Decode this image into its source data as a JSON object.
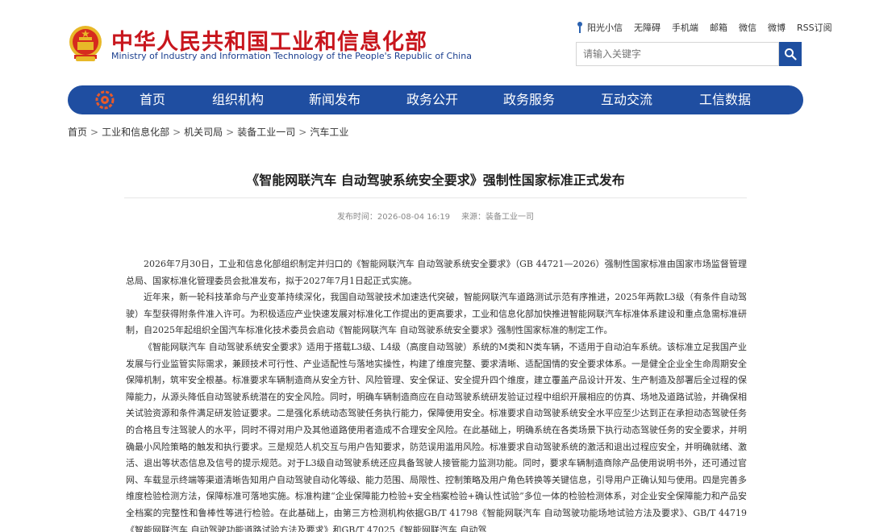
{
  "header": {
    "title_cn": "中华人民共和国工业和信息化部",
    "title_en": "Ministry of Industry and Information Technology of the People's Republic of China",
    "emblem_icon": "national-emblem-icon",
    "top_links": [
      "阳光小信",
      "无障碍",
      "手机端",
      "邮箱",
      "微信",
      "微博",
      "RSS订阅"
    ],
    "search": {
      "placeholder": "请输入关键字"
    }
  },
  "nav": {
    "items": [
      "首页",
      "组织机构",
      "新闻发布",
      "政务公开",
      "政务服务",
      "互动交流",
      "工信数据"
    ]
  },
  "breadcrumb": [
    "首页",
    "工业和信息化部",
    "机关司局",
    "装备工业一司",
    "汽车工业"
  ],
  "article": {
    "title": "《智能网联汽车 自动驾驶系统安全要求》强制性国家标准正式发布",
    "publish_time_label": "发布时间：2026-08-04 16:19",
    "source_label": "来源：装备工业一司",
    "paragraphs": [
      "2026年7月30日，工业和信息化部组织制定并归口的《智能网联汽车 自动驾驶系统安全要求》（GB 44721—2026）强制性国家标准由国家市场监督管理总局、国家标准化管理委员会批准发布，拟于2027年7月1日起正式实施。",
      "近年来，新一轮科技革命与产业变革持续深化，我国自动驾驶技术加速迭代突破，智能网联汽车道路测试示范有序推进，2025年两款L3级（有条件自动驾驶）车型获得附条件准入许可。为积极适应产业快速发展对标准化工作提出的更高要求，工业和信息化部加快推进智能网联汽车标准体系建设和重点急需标准研制，自2025年起组织全国汽车标准化技术委员会启动《智能网联汽车 自动驾驶系统安全要求》强制性国家标准的制定工作。",
      "《智能网联汽车 自动驾驶系统安全要求》适用于搭载L3级、L4级（高度自动驾驶）系统的M类和N类车辆，不适用于自动泊车系统。该标准立足我国产业发展与行业监管实际需求，兼顾技术可行性、产业适配性与落地实操性，构建了维度完整、要求清晰、适配国情的安全要求体系。一是健全企业全生命周期安全保障机制，筑牢安全根基。标准要求车辆制造商从安全方针、风险管理、安全保证、安全提升四个维度，建立覆盖产品设计开发、生产制造及部署后全过程的保障能力，从源头降低自动驾驶系统潜在的安全风险。同时，明确车辆制造商应在自动驾驶系统研发验证过程中组织开展相应的仿真、场地及道路试验，并确保相关试验资源和条件满足研发验证要求。二是强化系统动态驾驶任务执行能力，保障使用安全。标准要求自动驾驶系统安全水平应至少达到正在承担动态驾驶任务的合格且专注驾驶人的水平，同时不得对用户及其他道路使用者造成不合理安全风险。在此基础上，明确系统在各类场景下执行动态驾驶任务的安全要求，并明确最小风险策略的触发和执行要求。三是规范人机交互与用户告知要求，防范误用滥用风险。标准要求自动驾驶系统的激活和退出过程应安全，并明确就绪、激活、退出等状态信息及信号的提示规范。对于L3级自动驾驶系统还应具备驾驶人接管能力监测功能。同时，要求车辆制造商除产品使用说明书外，还可通过官网、车载显示终端等渠道清晰告知用户自动驾驶自动化等级、能力范围、局限性、控制策略及用户角色转换等关键信息，引导用户正确认知与使用。四是完善多维度检验检测方法，保障标准可落地实施。标准构建“企业保障能力检验+安全档案检验+确认性试验”多位一体的检验检测体系，对企业安全保障能力和产品安全档案的完整性和鲁棒性等进行检验。在此基础上，由第三方检测机构依据GB/T 41798《智能网联汽车 自动驾驶功能场地试验方法及要求》、GB/T 44719《智能网联汽车 自动驾驶功能道路试验方法及要求》和GB/T 47025《智能网联汽车 自动驾"
    ]
  },
  "colors": {
    "brand_red": "#c8161d",
    "nav_blue": "#1f4ea1",
    "search_blue": "#1e4fa0"
  }
}
